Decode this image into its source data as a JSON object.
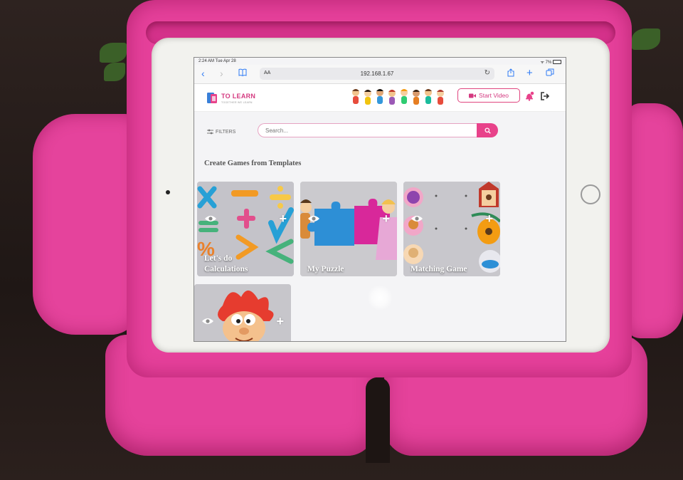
{
  "status_bar": {
    "time": "2:24 AM  Tue Apr 28",
    "battery": "7%"
  },
  "browser": {
    "aa_label": "AA",
    "url": "192.168.1.67",
    "icons": [
      "back-icon",
      "forward-icon",
      "bookmarks-icon",
      "reload-icon",
      "share-icon",
      "new-tab-icon",
      "tabs-icon"
    ]
  },
  "app": {
    "logo_text": "TO LEARN",
    "logo_sub": "TOGETHER WE LEARN",
    "start_video_label": "Start Video",
    "accent_color": "#e8428a"
  },
  "toolbar": {
    "filters_label": "FILTERS",
    "search_placeholder": "Search..."
  },
  "section": {
    "title": "Create Games from Templates"
  },
  "cards": [
    {
      "title_line1": "Let's do",
      "title_line2": "Calculations"
    },
    {
      "title_line1": "My Puzzle",
      "title_line2": ""
    },
    {
      "title_line1": "Matching Game",
      "title_line2": ""
    },
    {
      "title_line1": "",
      "title_line2": ""
    }
  ]
}
